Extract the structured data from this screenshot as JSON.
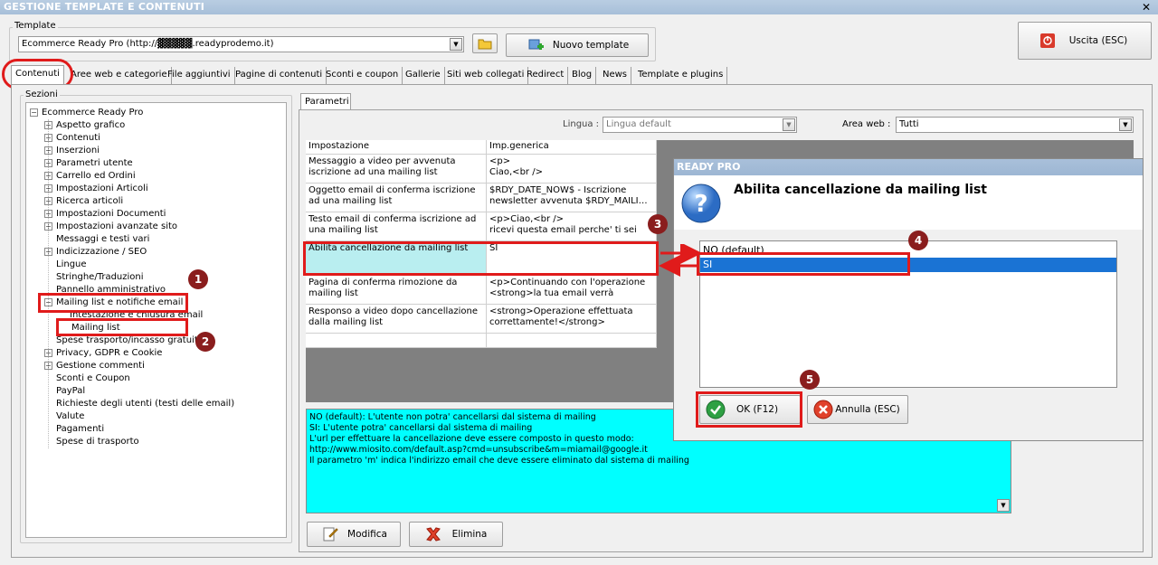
{
  "window": {
    "title": "GESTIONE TEMPLATE E CONTENUTI",
    "close_glyph": "✕"
  },
  "template_group": {
    "label": "Template",
    "selected_value": "Ecommerce Ready Pro (http://▓▓▓▓▓.readyprodemo.it)",
    "new_template_label": "Nuovo template",
    "exit_label": "Uscita (ESC)"
  },
  "tabs": [
    "Contenuti",
    "Aree web e categorie",
    "File aggiuntivi",
    "Pagine di contenuti",
    "Sconti e coupon",
    "Gallerie",
    "Siti web collegati",
    "Redirect",
    "Blog",
    "News",
    "Template e plugins"
  ],
  "sections": {
    "label": "Sezioni",
    "root": "Ecommerce Ready Pro",
    "items": [
      "Aspetto grafico",
      "Contenuti",
      "Inserzioni",
      "Parametri utente",
      "Carrello ed Ordini",
      "Impostazioni Articoli",
      "Ricerca articoli",
      "Impostazioni Documenti",
      "Impostazioni avanzate sito",
      "Messaggi e testi vari",
      "Indicizzazione / SEO",
      "Lingue",
      "Stringhe/Traduzioni",
      "Pannello amministrativo",
      "Mailing list e notifiche email",
      "Intestazione e chiusura email",
      "Mailing list",
      "Spese trasporto/incasso gratuite",
      "Privacy, GDPR e Cookie",
      "Gestione commenti",
      "Sconti e Coupon",
      "PayPal",
      "Richieste degli utenti (testi delle email)",
      "Valute",
      "Pagamenti",
      "Spese di trasporto"
    ]
  },
  "params": {
    "tab_label": "Parametri",
    "lingua_label": "Lingua :",
    "lingua_value": "Lingua default",
    "area_label": "Area web :",
    "area_value": "Tutti",
    "col_setting": "Impostazione",
    "col_value": "Imp.generica",
    "rows": [
      {
        "setting": "Messaggio a video per avvenuta iscrizione ad una mailing list",
        "value": "<p>\n Ciao,<br />"
      },
      {
        "setting": "Oggetto email di conferma iscrizione ad una mailing list",
        "value": "$RDY_DATE_NOW$ - Iscrizione newsletter avvenuta $RDY_MAILI…"
      },
      {
        "setting": "Testo email di conferma iscrizione ad una mailing list",
        "value": "<p>Ciao,<br />\nricevi questa email perche' ti sei"
      },
      {
        "setting": "Abilita cancellazione da mailing list",
        "value": "SI"
      },
      {
        "setting": "Pagina di conferma rimozione da mailing list",
        "value": "<p>Continuando con l'operazione <strong>la tua email verrà"
      },
      {
        "setting": "Responso a video dopo cancellazione dalla mailing list",
        "value": "<strong>Operazione effettuata correttamente!</strong>"
      }
    ],
    "description": "NO (default): L'utente non potra' cancellarsi dal sistema di mailing\nSI: L'utente potra' cancellarsi dal sistema di mailing\nL'url per effettuare la cancellazione deve essere composto in questo modo:\nhttp://www.miosito.com/default.asp?cmd=unsubscribe&m=miamail@google.it\nIl parametro 'm' indica l'indirizzo email che deve essere eliminato dal sistema di mailing",
    "edit_label": "Modifica",
    "delete_label": "Elimina"
  },
  "dialog": {
    "title": "READY PRO",
    "heading": "Abilita cancellazione da mailing list",
    "options": [
      "NO (default)",
      "SI"
    ],
    "selected_index": 1,
    "ok_label": "OK (F12)",
    "cancel_label": "Annulla (ESC)"
  },
  "annotations": [
    "1",
    "2",
    "3",
    "4",
    "5"
  ],
  "colors": {
    "highlight_red": "#e01b1b",
    "annot_circle": "#8a1d1d",
    "selection_blue": "#1a73d4",
    "cyan": "#00ffff"
  }
}
